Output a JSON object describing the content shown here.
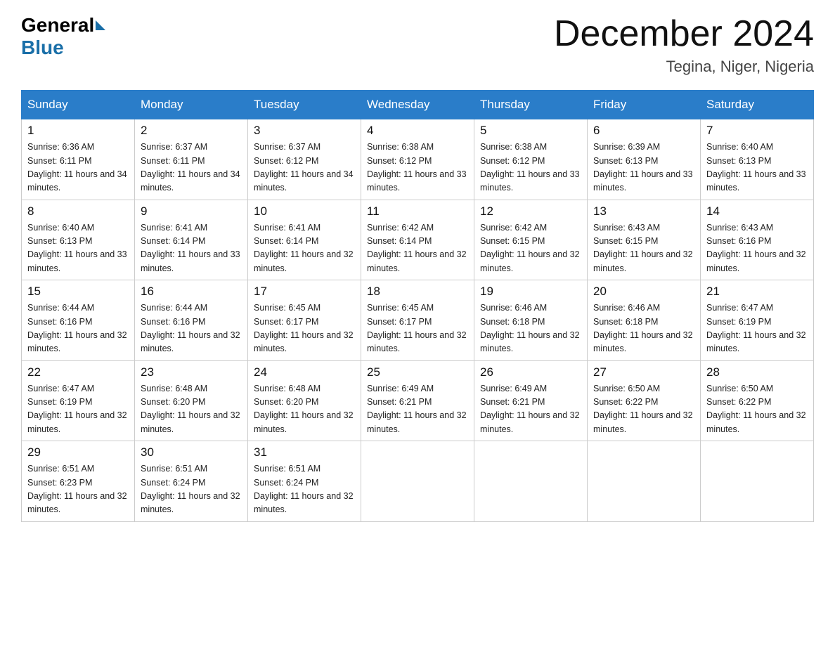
{
  "header": {
    "logo_general": "General",
    "logo_blue": "Blue",
    "month_title": "December 2024",
    "location": "Tegina, Niger, Nigeria"
  },
  "weekdays": [
    "Sunday",
    "Monday",
    "Tuesday",
    "Wednesday",
    "Thursday",
    "Friday",
    "Saturday"
  ],
  "weeks": [
    [
      {
        "day": "1",
        "sunrise": "6:36 AM",
        "sunset": "6:11 PM",
        "daylight": "11 hours and 34 minutes."
      },
      {
        "day": "2",
        "sunrise": "6:37 AM",
        "sunset": "6:11 PM",
        "daylight": "11 hours and 34 minutes."
      },
      {
        "day": "3",
        "sunrise": "6:37 AM",
        "sunset": "6:12 PM",
        "daylight": "11 hours and 34 minutes."
      },
      {
        "day": "4",
        "sunrise": "6:38 AM",
        "sunset": "6:12 PM",
        "daylight": "11 hours and 33 minutes."
      },
      {
        "day": "5",
        "sunrise": "6:38 AM",
        "sunset": "6:12 PM",
        "daylight": "11 hours and 33 minutes."
      },
      {
        "day": "6",
        "sunrise": "6:39 AM",
        "sunset": "6:13 PM",
        "daylight": "11 hours and 33 minutes."
      },
      {
        "day": "7",
        "sunrise": "6:40 AM",
        "sunset": "6:13 PM",
        "daylight": "11 hours and 33 minutes."
      }
    ],
    [
      {
        "day": "8",
        "sunrise": "6:40 AM",
        "sunset": "6:13 PM",
        "daylight": "11 hours and 33 minutes."
      },
      {
        "day": "9",
        "sunrise": "6:41 AM",
        "sunset": "6:14 PM",
        "daylight": "11 hours and 33 minutes."
      },
      {
        "day": "10",
        "sunrise": "6:41 AM",
        "sunset": "6:14 PM",
        "daylight": "11 hours and 32 minutes."
      },
      {
        "day": "11",
        "sunrise": "6:42 AM",
        "sunset": "6:14 PM",
        "daylight": "11 hours and 32 minutes."
      },
      {
        "day": "12",
        "sunrise": "6:42 AM",
        "sunset": "6:15 PM",
        "daylight": "11 hours and 32 minutes."
      },
      {
        "day": "13",
        "sunrise": "6:43 AM",
        "sunset": "6:15 PM",
        "daylight": "11 hours and 32 minutes."
      },
      {
        "day": "14",
        "sunrise": "6:43 AM",
        "sunset": "6:16 PM",
        "daylight": "11 hours and 32 minutes."
      }
    ],
    [
      {
        "day": "15",
        "sunrise": "6:44 AM",
        "sunset": "6:16 PM",
        "daylight": "11 hours and 32 minutes."
      },
      {
        "day": "16",
        "sunrise": "6:44 AM",
        "sunset": "6:16 PM",
        "daylight": "11 hours and 32 minutes."
      },
      {
        "day": "17",
        "sunrise": "6:45 AM",
        "sunset": "6:17 PM",
        "daylight": "11 hours and 32 minutes."
      },
      {
        "day": "18",
        "sunrise": "6:45 AM",
        "sunset": "6:17 PM",
        "daylight": "11 hours and 32 minutes."
      },
      {
        "day": "19",
        "sunrise": "6:46 AM",
        "sunset": "6:18 PM",
        "daylight": "11 hours and 32 minutes."
      },
      {
        "day": "20",
        "sunrise": "6:46 AM",
        "sunset": "6:18 PM",
        "daylight": "11 hours and 32 minutes."
      },
      {
        "day": "21",
        "sunrise": "6:47 AM",
        "sunset": "6:19 PM",
        "daylight": "11 hours and 32 minutes."
      }
    ],
    [
      {
        "day": "22",
        "sunrise": "6:47 AM",
        "sunset": "6:19 PM",
        "daylight": "11 hours and 32 minutes."
      },
      {
        "day": "23",
        "sunrise": "6:48 AM",
        "sunset": "6:20 PM",
        "daylight": "11 hours and 32 minutes."
      },
      {
        "day": "24",
        "sunrise": "6:48 AM",
        "sunset": "6:20 PM",
        "daylight": "11 hours and 32 minutes."
      },
      {
        "day": "25",
        "sunrise": "6:49 AM",
        "sunset": "6:21 PM",
        "daylight": "11 hours and 32 minutes."
      },
      {
        "day": "26",
        "sunrise": "6:49 AM",
        "sunset": "6:21 PM",
        "daylight": "11 hours and 32 minutes."
      },
      {
        "day": "27",
        "sunrise": "6:50 AM",
        "sunset": "6:22 PM",
        "daylight": "11 hours and 32 minutes."
      },
      {
        "day": "28",
        "sunrise": "6:50 AM",
        "sunset": "6:22 PM",
        "daylight": "11 hours and 32 minutes."
      }
    ],
    [
      {
        "day": "29",
        "sunrise": "6:51 AM",
        "sunset": "6:23 PM",
        "daylight": "11 hours and 32 minutes."
      },
      {
        "day": "30",
        "sunrise": "6:51 AM",
        "sunset": "6:24 PM",
        "daylight": "11 hours and 32 minutes."
      },
      {
        "day": "31",
        "sunrise": "6:51 AM",
        "sunset": "6:24 PM",
        "daylight": "11 hours and 32 minutes."
      },
      null,
      null,
      null,
      null
    ]
  ]
}
